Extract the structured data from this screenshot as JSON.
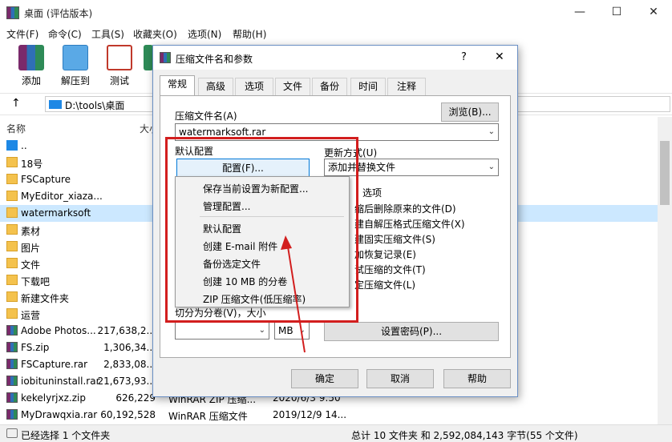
{
  "window": {
    "title": "桌面 (评估版本)",
    "min": "—",
    "max": "☐",
    "close": "✕"
  },
  "menu": [
    "文件(F)",
    "命令(C)",
    "工具(S)",
    "收藏夹(O)",
    "选项(N)",
    "帮助(H)"
  ],
  "toolbar": [
    "添加",
    "解压到",
    "测试"
  ],
  "address": {
    "path": "D:\\tools\\桌面"
  },
  "columns": {
    "name": "名称",
    "size": "大小"
  },
  "files": [
    {
      "name": "..",
      "size": "",
      "type": "",
      "date": "",
      "kind": "up"
    },
    {
      "name": "18号",
      "size": "",
      "type": "",
      "date": "",
      "kind": "folder"
    },
    {
      "name": "FSCapture",
      "size": "",
      "type": "",
      "date": "",
      "kind": "folder"
    },
    {
      "name": "MyEditor_xiaza...",
      "size": "",
      "type": "",
      "date": "",
      "kind": "folder"
    },
    {
      "name": "watermarksoft",
      "size": "",
      "type": "",
      "date": "",
      "kind": "folder-sel"
    },
    {
      "name": "素材",
      "size": "",
      "type": "",
      "date": "",
      "kind": "folder"
    },
    {
      "name": "图片",
      "size": "",
      "type": "",
      "date": "",
      "kind": "folder"
    },
    {
      "name": "文件",
      "size": "",
      "type": "",
      "date": "",
      "kind": "folder"
    },
    {
      "name": "下载吧",
      "size": "",
      "type": "",
      "date": "",
      "kind": "folder"
    },
    {
      "name": "新建文件夹",
      "size": "",
      "type": "",
      "date": "",
      "kind": "folder"
    },
    {
      "name": "运营",
      "size": "",
      "type": "",
      "date": "",
      "kind": "folder"
    },
    {
      "name": "Adobe Photos...",
      "size": "217,638,2...",
      "type": "",
      "date": "",
      "kind": "rar"
    },
    {
      "name": "FS.zip",
      "size": "1,306,34...",
      "type": "",
      "date": "",
      "kind": "rar"
    },
    {
      "name": "FSCapture.rar",
      "size": "2,833,08...",
      "type": "",
      "date": "",
      "kind": "rar"
    },
    {
      "name": "iobituninstall.rar",
      "size": "21,673,93...",
      "type": "",
      "date": "",
      "kind": "rar"
    },
    {
      "name": "kekelyrjxz.zip",
      "size": "626,229",
      "type": "WinRAR ZIP 压缩...",
      "date": "2020/6/3 9:50",
      "kind": "rar"
    },
    {
      "name": "MyDrawqxia.rar",
      "size": "60,192,528",
      "type": "WinRAR 压缩文件",
      "date": "2019/12/9 14...",
      "kind": "rar"
    }
  ],
  "status": {
    "left": "已经选择 1 个文件夹",
    "right": "总计 10 文件夹 和 2,592,084,143 字节(55 个文件)"
  },
  "dialog": {
    "title": "压缩文件名和参数",
    "help": "?",
    "close": "✕",
    "tabs": [
      "常规",
      "高级",
      "选项",
      "文件",
      "备份",
      "时间",
      "注释"
    ],
    "archive_label": "压缩文件名(A)",
    "browse": "浏览(B)...",
    "archive_name": "watermarksoft.rar",
    "default_profile": "默认配置",
    "profile_btn": "配置(F)...",
    "update_label": "更新方式(U)",
    "update_value": "添加并替换文件",
    "options_label": "选项",
    "options": [
      "缩后删除原来的文件(D)",
      "建自解压格式压缩文件(X)",
      "建固实压缩文件(S)",
      "加恢复记录(E)",
      "试压缩的文件(T)",
      "定压缩文件(L)"
    ],
    "split_label": "切分为分卷(V)，大小",
    "unit": "MB",
    "password_btn": "设置密码(P)...",
    "ok": "确定",
    "cancel": "取消",
    "helpbtn": "帮助"
  },
  "popup": [
    "保存当前设置为新配置...",
    "管理配置...",
    "默认配置",
    "创建 E-mail 附件",
    "备份选定文件",
    "创建 10 MB 的分卷",
    "ZIP 压缩文件(低压缩率)"
  ],
  "colors": {
    "accent": "#0078d7",
    "highlight": "#d21e1e"
  }
}
